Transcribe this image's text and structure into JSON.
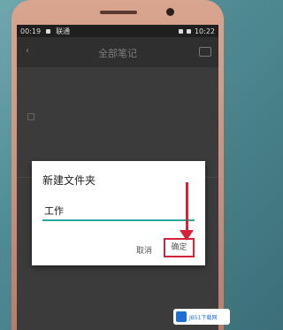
{
  "status": {
    "time_left": "00:19",
    "carrier": "联通",
    "time_right": "10:22"
  },
  "app": {
    "title": "全部笔记"
  },
  "dialog": {
    "title": "新建文件夹",
    "input_value": "工作",
    "cancel": "取消",
    "ok": "确定"
  },
  "watermark": {
    "text": "JB51下载网"
  },
  "colors": {
    "accent": "#2aa79b",
    "highlight": "#d4243a"
  }
}
